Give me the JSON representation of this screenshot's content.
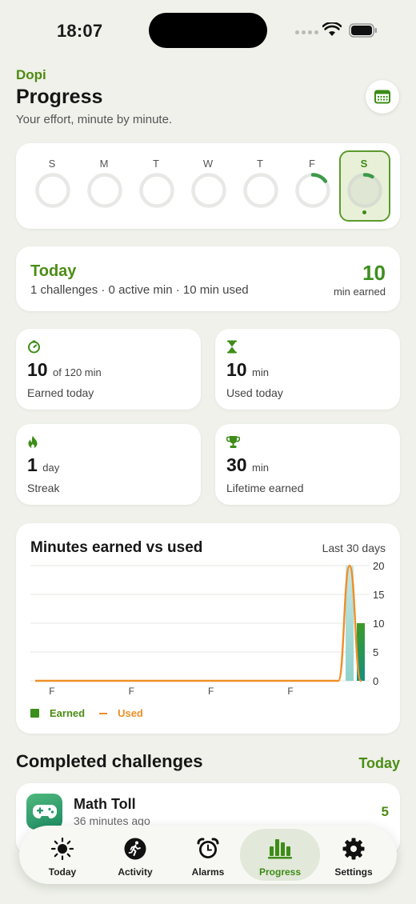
{
  "status_bar": {
    "time": "18:07"
  },
  "header": {
    "app_name": "Dopi",
    "title": "Progress",
    "subtitle": "Your effort, minute by minute.",
    "calendar_icon": "calendar-icon"
  },
  "week": {
    "days": [
      {
        "letter": "S",
        "progress": 0
      },
      {
        "letter": "M",
        "progress": 0
      },
      {
        "letter": "T",
        "progress": 0
      },
      {
        "letter": "W",
        "progress": 0
      },
      {
        "letter": "T",
        "progress": 0
      },
      {
        "letter": "F",
        "progress": 0.15
      },
      {
        "letter": "S",
        "progress": 0.08,
        "selected": true
      }
    ]
  },
  "today": {
    "title": "Today",
    "detail": "1 challenges · 0 active min · 10 min used",
    "earned_value": "10",
    "earned_label": "min earned"
  },
  "stats": {
    "earned": {
      "value": "10",
      "unit": "of 120 min",
      "label": "Earned today",
      "icon": "timer-icon"
    },
    "used": {
      "value": "10",
      "unit": "min",
      "label": "Used today",
      "icon": "hourglass-icon"
    },
    "streak": {
      "value": "1",
      "unit": "day",
      "label": "Streak",
      "icon": "flame-icon"
    },
    "lifetime": {
      "value": "30",
      "unit": "min",
      "label": "Lifetime earned",
      "icon": "trophy-icon"
    }
  },
  "chart": {
    "title": "Minutes earned vs used",
    "range": "Last 30 days",
    "legend_earned": "Earned",
    "legend_used": "Used"
  },
  "chart_data": {
    "type": "bar",
    "title": "Minutes earned vs used",
    "x_tick_labels": [
      "F",
      "F",
      "F",
      "F"
    ],
    "y_ticks": [
      0,
      5,
      10,
      15,
      20
    ],
    "ylim": [
      0,
      20
    ],
    "grid": true,
    "legend": "bottom-left",
    "series": [
      {
        "name": "Earned",
        "kind": "bar",
        "color": "#3b8e1a",
        "values": [
          0,
          0,
          0,
          0,
          0,
          0,
          0,
          0,
          0,
          0,
          0,
          0,
          0,
          0,
          0,
          0,
          0,
          0,
          0,
          0,
          0,
          0,
          0,
          0,
          0,
          0,
          0,
          0,
          20,
          10
        ]
      },
      {
        "name": "Used",
        "kind": "line",
        "color": "#ef8f27",
        "values": [
          0,
          0,
          0,
          0,
          0,
          0,
          0,
          0,
          0,
          0,
          0,
          0,
          0,
          0,
          0,
          0,
          0,
          0,
          0,
          0,
          0,
          0,
          0,
          0,
          0,
          0,
          0,
          0,
          20,
          0
        ]
      }
    ]
  },
  "completed": {
    "title": "Completed challenges",
    "link": "Today",
    "items": [
      {
        "name": "Math Toll",
        "time": "36 minutes ago",
        "minutes": "5",
        "icon": "gamepad-icon"
      }
    ]
  },
  "tabs": [
    {
      "label": "Today",
      "icon": "sun-icon"
    },
    {
      "label": "Activity",
      "icon": "running-icon"
    },
    {
      "label": "Alarms",
      "icon": "alarm-clock-icon"
    },
    {
      "label": "Progress",
      "icon": "bar-chart-icon",
      "active": true
    },
    {
      "label": "Settings",
      "icon": "gear-icon"
    }
  ],
  "colors": {
    "accent": "#4b8d14",
    "earned": "#3b8e1a",
    "used": "#ef8f27",
    "background": "#eff1ea"
  }
}
